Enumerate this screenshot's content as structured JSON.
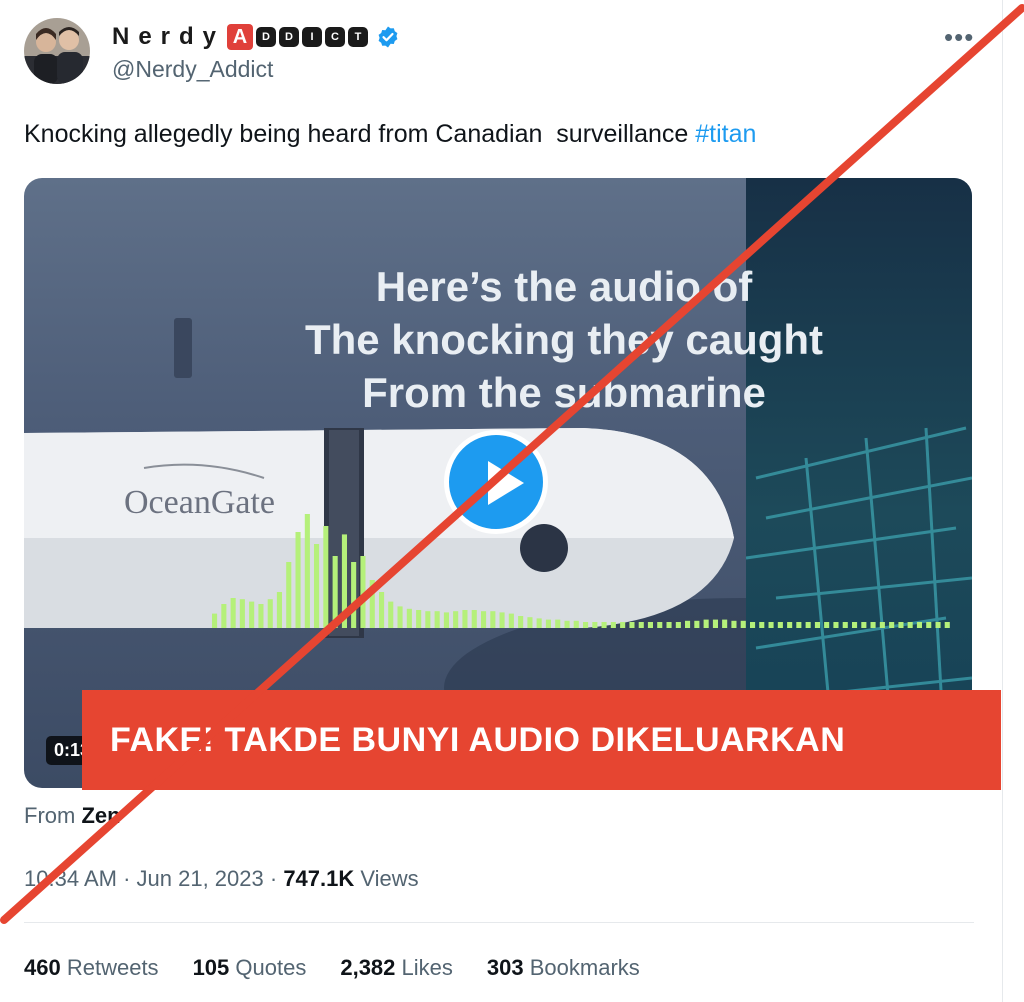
{
  "author": {
    "display_name": "Nerdy",
    "logo_letters": [
      "A",
      "D",
      "D",
      "I",
      "C",
      "T"
    ],
    "handle": "@Nerdy_Addict",
    "verified_icon": "verified-badge-icon"
  },
  "menu": {
    "more_label": "•••"
  },
  "tweet": {
    "text": "Knocking allegedly being heard from Canadian  surveillance ",
    "hashtag": "#titan"
  },
  "media": {
    "overlay_lines": [
      "Here’s the audio of",
      "The knocking they caught",
      "From the submarine"
    ],
    "timestamp": "0:13",
    "play_icon": "play-icon",
    "logo_text": "OceanGate",
    "waveform_levels": [
      0.12,
      0.2,
      0.25,
      0.24,
      0.22,
      0.2,
      0.24,
      0.3,
      0.55,
      0.8,
      0.95,
      0.7,
      0.85,
      0.6,
      0.78,
      0.55,
      0.6,
      0.4,
      0.3,
      0.22,
      0.18,
      0.16,
      0.15,
      0.14,
      0.14,
      0.13,
      0.14,
      0.15,
      0.15,
      0.14,
      0.14,
      0.13,
      0.12,
      0.1,
      0.09,
      0.08,
      0.07,
      0.07,
      0.06,
      0.06,
      0.05,
      0.05,
      0.05,
      0.05,
      0.05,
      0.04,
      0.04,
      0.04,
      0.05,
      0.05,
      0.05,
      0.06,
      0.06,
      0.07,
      0.07,
      0.07,
      0.06,
      0.06,
      0.05,
      0.05,
      0.05,
      0.05,
      0.05,
      0.04,
      0.04,
      0.04,
      0.04,
      0.04,
      0.04,
      0.04,
      0.04,
      0.03,
      0.03,
      0.03,
      0.03,
      0.03,
      0.03,
      0.03,
      0.03,
      0.03
    ]
  },
  "source": {
    "prefix": "From ",
    "name": "Zen"
  },
  "meta": {
    "time": "10:34 AM",
    "separator": " · ",
    "date": "Jun 21, 2023",
    "views_count": "747.1K",
    "views_label": " Views"
  },
  "stats": [
    {
      "count": "460",
      "label": "Retweets"
    },
    {
      "count": "105",
      "label": "Quotes"
    },
    {
      "count": "2,382",
      "label": "Likes"
    },
    {
      "count": "303",
      "label": "Bookmarks"
    }
  ],
  "annotation": {
    "banner_text": "FAKE! TAKDE BUNYI AUDIO DIKELUARKAN",
    "strike_color": "#e64531"
  },
  "colors": {
    "link": "#1d9bf0",
    "muted": "#536471",
    "text": "#0f1419",
    "verified": "#1d9bf0"
  }
}
